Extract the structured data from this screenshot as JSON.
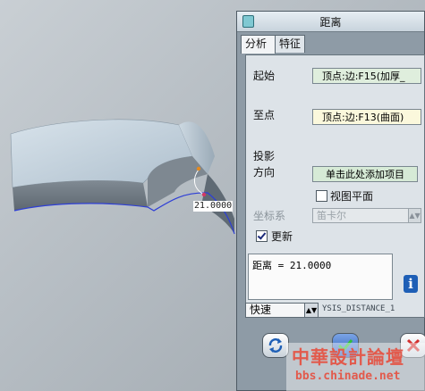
{
  "viewport": {
    "dimension_value": "21.0000",
    "colors": {
      "part_top": "#c5d4e0",
      "part_side": "#6e7882",
      "edge_highlight": "#2e3fd6",
      "dim_line": "#ffffff"
    }
  },
  "dialog": {
    "title": "距离",
    "tabs": [
      "分析",
      "特征"
    ],
    "active_tab": "分析",
    "start_label": "起始",
    "start_value": "顶点:边:F15(加厚_",
    "end_label": "至点",
    "end_value": "顶点:边:F13(曲面)",
    "projection_label_1": "投影",
    "projection_label_2": "方向",
    "projection_button": "单击此处添加项目",
    "view_plane_label": "视图平面",
    "view_plane_checked": false,
    "coord_label": "坐标系",
    "coord_value": "笛卡尔",
    "update_label": "更新",
    "update_checked": true,
    "result_text": "距离 = 21.0000",
    "info_icon": "i",
    "speed_value": "快速",
    "feature_name": "YSIS_DISTANCE_1"
  },
  "buttons": {
    "repeat_icon": "repeat-icon",
    "ok_icon": "check-icon",
    "cancel_icon": "close-icon"
  },
  "watermark": {
    "text": "中華設計論壇",
    "url": "bbs.chinade.net"
  }
}
